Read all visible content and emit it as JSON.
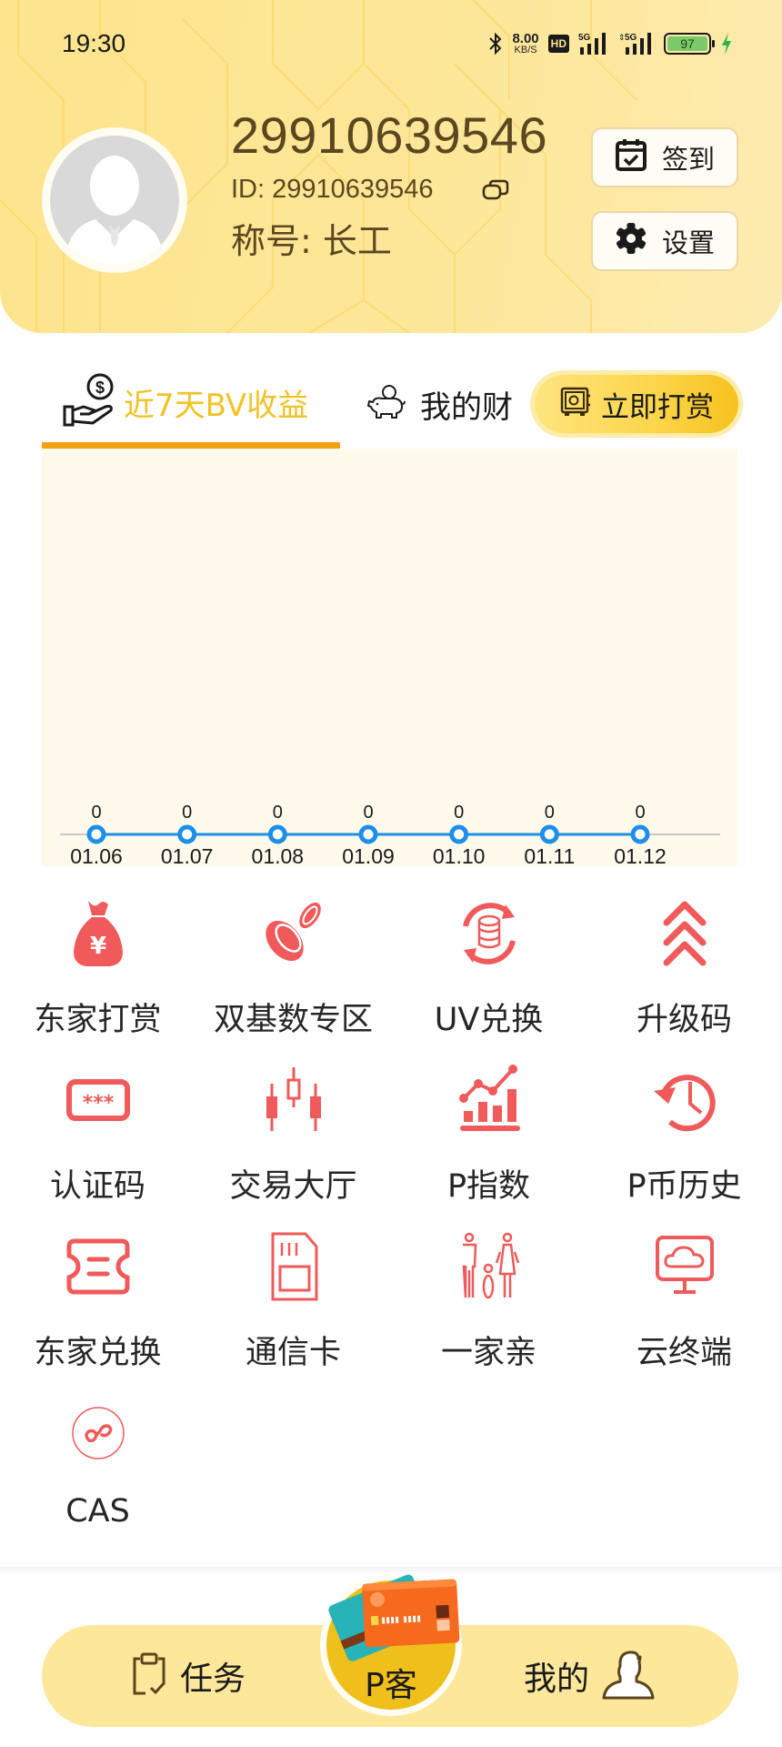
{
  "status_bar": {
    "time": "19:30",
    "net_speed_value": "8.00",
    "net_speed_unit": "KB/S",
    "hd_label": "HD",
    "signal1_label": "5G",
    "signal2_label": "5G",
    "battery": "97"
  },
  "profile": {
    "name": "29910639546",
    "id_label": "ID:",
    "id_value": "29910639546",
    "title_label": "称号:",
    "title_value": "长工",
    "checkin_label": "签到",
    "settings_label": "设置"
  },
  "tabs": {
    "bv_earnings": "近7天BV收益",
    "my_wealth": "我的财",
    "reward_now": "立即打赏"
  },
  "chart_data": {
    "type": "line",
    "title": "近7天BV收益",
    "categories": [
      "01.06",
      "01.07",
      "01.08",
      "01.09",
      "01.10",
      "01.11",
      "01.12"
    ],
    "values": [
      0,
      0,
      0,
      0,
      0,
      0,
      0
    ],
    "value_labels": [
      "0",
      "0",
      "0",
      "0",
      "0",
      "0",
      "0"
    ],
    "xlabel": "",
    "ylabel": "",
    "grid": false,
    "legend": "none",
    "line_color": "#1e8fe6"
  },
  "grid": {
    "items": [
      {
        "label": "东家打赏",
        "icon": "money-bag-icon"
      },
      {
        "label": "双基数专区",
        "icon": "coins-icon"
      },
      {
        "label": "UV兑换",
        "icon": "coin-exchange-icon"
      },
      {
        "label": "升级码",
        "icon": "chevrons-up-icon"
      },
      {
        "label": "认证码",
        "icon": "password-field-icon"
      },
      {
        "label": "交易大厅",
        "icon": "candlestick-icon"
      },
      {
        "label": "P指数",
        "icon": "chart-trend-icon"
      },
      {
        "label": "P币历史",
        "icon": "history-clock-icon"
      },
      {
        "label": "东家兑换",
        "icon": "ticket-icon"
      },
      {
        "label": "通信卡",
        "icon": "sim-card-icon"
      },
      {
        "label": "一家亲",
        "icon": "family-icon"
      },
      {
        "label": "云终端",
        "icon": "cloud-monitor-icon"
      },
      {
        "label": "CAS",
        "icon": "mini-program-icon"
      }
    ],
    "accent_color": "#f05a5a"
  },
  "bottom_nav": {
    "tasks": "任务",
    "center": "P客",
    "mine": "我的"
  }
}
